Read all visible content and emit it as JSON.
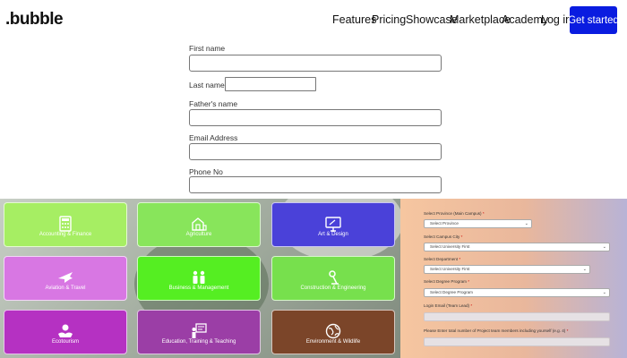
{
  "nav": {
    "logo": ".bubble",
    "links": [
      "Features",
      "Pricing",
      "Showcase",
      "Marketplace",
      "Academy",
      "Log in"
    ],
    "cta": "Get started"
  },
  "form": {
    "first_name_label": "First name",
    "last_name_label": "Last name",
    "fathers_name_label": "Father's name",
    "email_label": "Email Address",
    "phone_label": "Phone No"
  },
  "tiles": [
    {
      "label": "Accounting & Finance",
      "color": "#a6ee63",
      "icon": "calculator-icon"
    },
    {
      "label": "Agriculture",
      "color": "#88e55b",
      "icon": "farm-icon"
    },
    {
      "label": "Art & Design",
      "color": "#4a41d9",
      "icon": "monitor-icon"
    },
    {
      "label": "Aviation & Travel",
      "color": "#d877e3",
      "icon": "airplane-icon"
    },
    {
      "label": "Business & Management",
      "color": "#55ee22",
      "icon": "business-people-icon"
    },
    {
      "label": "Construction & Engineering",
      "color": "#77e04d",
      "icon": "engineering-icon"
    },
    {
      "label": "Ecotourism",
      "color": "#b531c2",
      "icon": "eco-hands-icon"
    },
    {
      "label": "Education, Training & Teaching",
      "color": "#9b3ea6",
      "icon": "teaching-board-icon"
    },
    {
      "label": "Environment & Wildlife",
      "color": "#7b4529",
      "icon": "globe-icon"
    }
  ],
  "panel": {
    "province_label": "Select Province (Main Campus)",
    "province_value": "Select Province",
    "city_label": "Select Campus City",
    "city_value": "Select University First",
    "department_label": "Select Department",
    "department_value": "Select University First",
    "degree_label": "Select Degree Program",
    "degree_value": "Select Degree Program",
    "login_email_label": "Login Email (Team Lead)",
    "members_label": "Please Enter total number of Project team members including yourself (e.g. 4)",
    "required_mark": "*"
  }
}
